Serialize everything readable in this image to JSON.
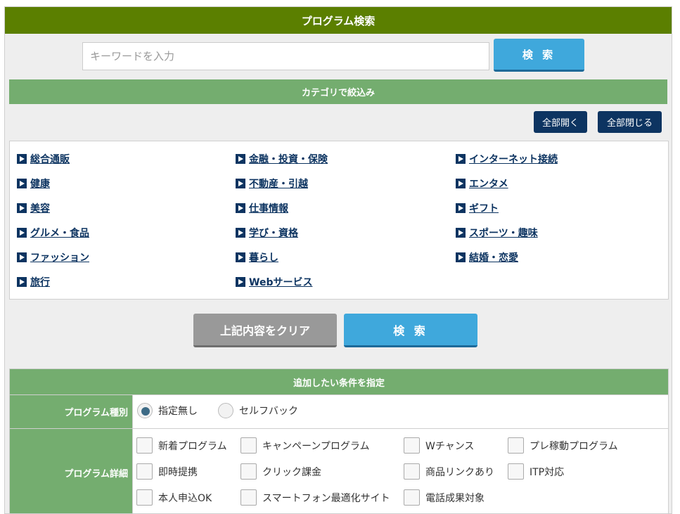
{
  "header": {
    "title": "プログラム検索"
  },
  "search": {
    "placeholder": "キーワードを入力",
    "button_label": "検 索"
  },
  "category": {
    "title": "カテゴリで絞込み",
    "open_all": "全部開く",
    "close_all": "全部閉じる",
    "columns": [
      [
        "総合通販",
        "健康",
        "美容",
        "グルメ・食品",
        "ファッション",
        "旅行"
      ],
      [
        "金融・投資・保険",
        "不動産・引越",
        "仕事情報",
        "学び・資格",
        "暮らし",
        "Webサービス"
      ],
      [
        "インターネット接続",
        "エンタメ",
        "ギフト",
        "スポーツ・趣味",
        "結婚・恋愛"
      ]
    ]
  },
  "actions": {
    "clear_label": "上記内容をクリア",
    "search_label": "検 索"
  },
  "conditions": {
    "title": "追加したい条件を指定",
    "program_type": {
      "label": "プログラム種別",
      "options": [
        "指定無し",
        "セルフバック"
      ],
      "selected": "指定無し"
    },
    "program_detail": {
      "label": "プログラム詳細",
      "options": [
        [
          "新着プログラム",
          "キャンペーンプログラム",
          "Wチャンス",
          "プレ稼動プログラム"
        ],
        [
          "即時提携",
          "クリック課金",
          "商品リンクあり",
          "ITP対応"
        ],
        [
          "本人申込OK",
          "スマートフォン最適化サイト",
          "電話成果対象"
        ]
      ]
    }
  },
  "colors": {
    "header": "#5b7f00",
    "section": "#74ad6f",
    "navy": "#0d3461",
    "search_button": "#3fa8dc",
    "clear_button": "#999999"
  }
}
